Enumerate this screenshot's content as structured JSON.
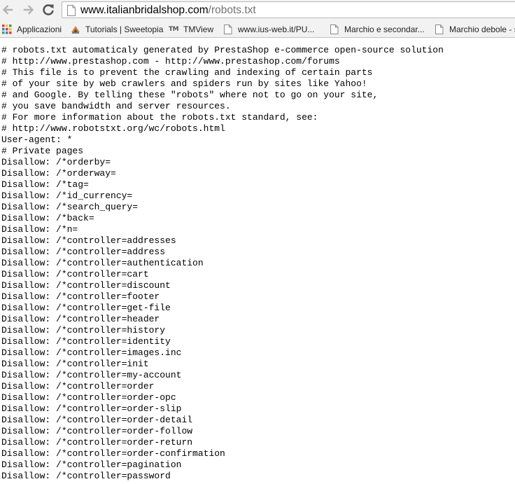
{
  "toolbar": {
    "url_domain": "www.italianbridalshop.com",
    "url_path": "/robots.txt"
  },
  "bookmarks": [
    {
      "label": "Applicazioni",
      "icon": "apps-grid-icon"
    },
    {
      "label": "Tutorials | Sweetopia",
      "icon": "sweetopia-icon"
    },
    {
      "label": "TMView",
      "icon": "tm-icon"
    },
    {
      "label": "www.ius-web.it/PU...",
      "icon": "page-icon"
    },
    {
      "label": "Marchio e secondar...",
      "icon": "page-icon"
    },
    {
      "label": "Marchio debole - s",
      "icon": "page-icon"
    }
  ],
  "content": {
    "lines": [
      "# robots.txt automaticaly generated by PrestaShop e-commerce open-source solution",
      "# http://www.prestashop.com - http://www.prestashop.com/forums",
      "# This file is to prevent the crawling and indexing of certain parts",
      "# of your site by web crawlers and spiders run by sites like Yahoo!",
      "# and Google. By telling these \"robots\" where not to go on your site,",
      "# you save bandwidth and server resources.",
      "# For more information about the robots.txt standard, see:",
      "# http://www.robotstxt.org/wc/robots.html",
      "User-agent: *",
      "# Private pages",
      "Disallow: /*orderby=",
      "Disallow: /*orderway=",
      "Disallow: /*tag=",
      "Disallow: /*id_currency=",
      "Disallow: /*search_query=",
      "Disallow: /*back=",
      "Disallow: /*n=",
      "Disallow: /*controller=addresses",
      "Disallow: /*controller=address",
      "Disallow: /*controller=authentication",
      "Disallow: /*controller=cart",
      "Disallow: /*controller=discount",
      "Disallow: /*controller=footer",
      "Disallow: /*controller=get-file",
      "Disallow: /*controller=header",
      "Disallow: /*controller=history",
      "Disallow: /*controller=identity",
      "Disallow: /*controller=images.inc",
      "Disallow: /*controller=init",
      "Disallow: /*controller=my-account",
      "Disallow: /*controller=order",
      "Disallow: /*controller=order-opc",
      "Disallow: /*controller=order-slip",
      "Disallow: /*controller=order-detail",
      "Disallow: /*controller=order-follow",
      "Disallow: /*controller=order-return",
      "Disallow: /*controller=order-confirmation",
      "Disallow: /*controller=pagination",
      "Disallow: /*controller=password"
    ]
  }
}
